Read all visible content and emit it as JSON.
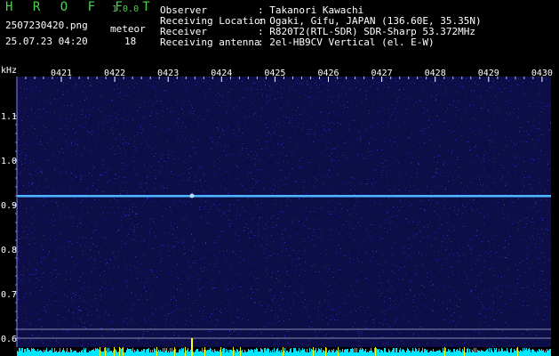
{
  "app": {
    "name": "H R O F F T",
    "version": "1.0.0"
  },
  "file": {
    "filename": "2507230420.png",
    "datetime": "25.07.23 04:20",
    "meteor_label": "meteor",
    "meteor_count": "18"
  },
  "info": [
    {
      "label": "Observer",
      "value": ": Takanori Kawachi"
    },
    {
      "label": "Receiving Location",
      "value": ": Ogaki, Gifu, JAPAN (136.60E, 35.35N)"
    },
    {
      "label": "Receiver",
      "value": ": R820T2(RTL-SDR) SDR-Sharp 53.372MHz"
    },
    {
      "label": "Receiving antenna",
      "value": ": 2el-HB9CV Vertical (el. E-W)"
    }
  ],
  "axis": {
    "unit": "kHz",
    "time_ticks": [
      "0421",
      "0422",
      "0423",
      "0424",
      "0425",
      "0426",
      "0427",
      "0428",
      "0429",
      "0430"
    ],
    "freq_ticks": [
      "1.1",
      "1.0",
      "0.9",
      "0.8",
      "0.7",
      "0.6"
    ]
  },
  "colors": {
    "background": "#000000",
    "spectrum_base": "#0d0d48",
    "carrier": "#4fb4ff",
    "power_bar": "#00e6ff",
    "meteor_mark": "#ffff00",
    "label_green": "#4cd34c"
  }
}
